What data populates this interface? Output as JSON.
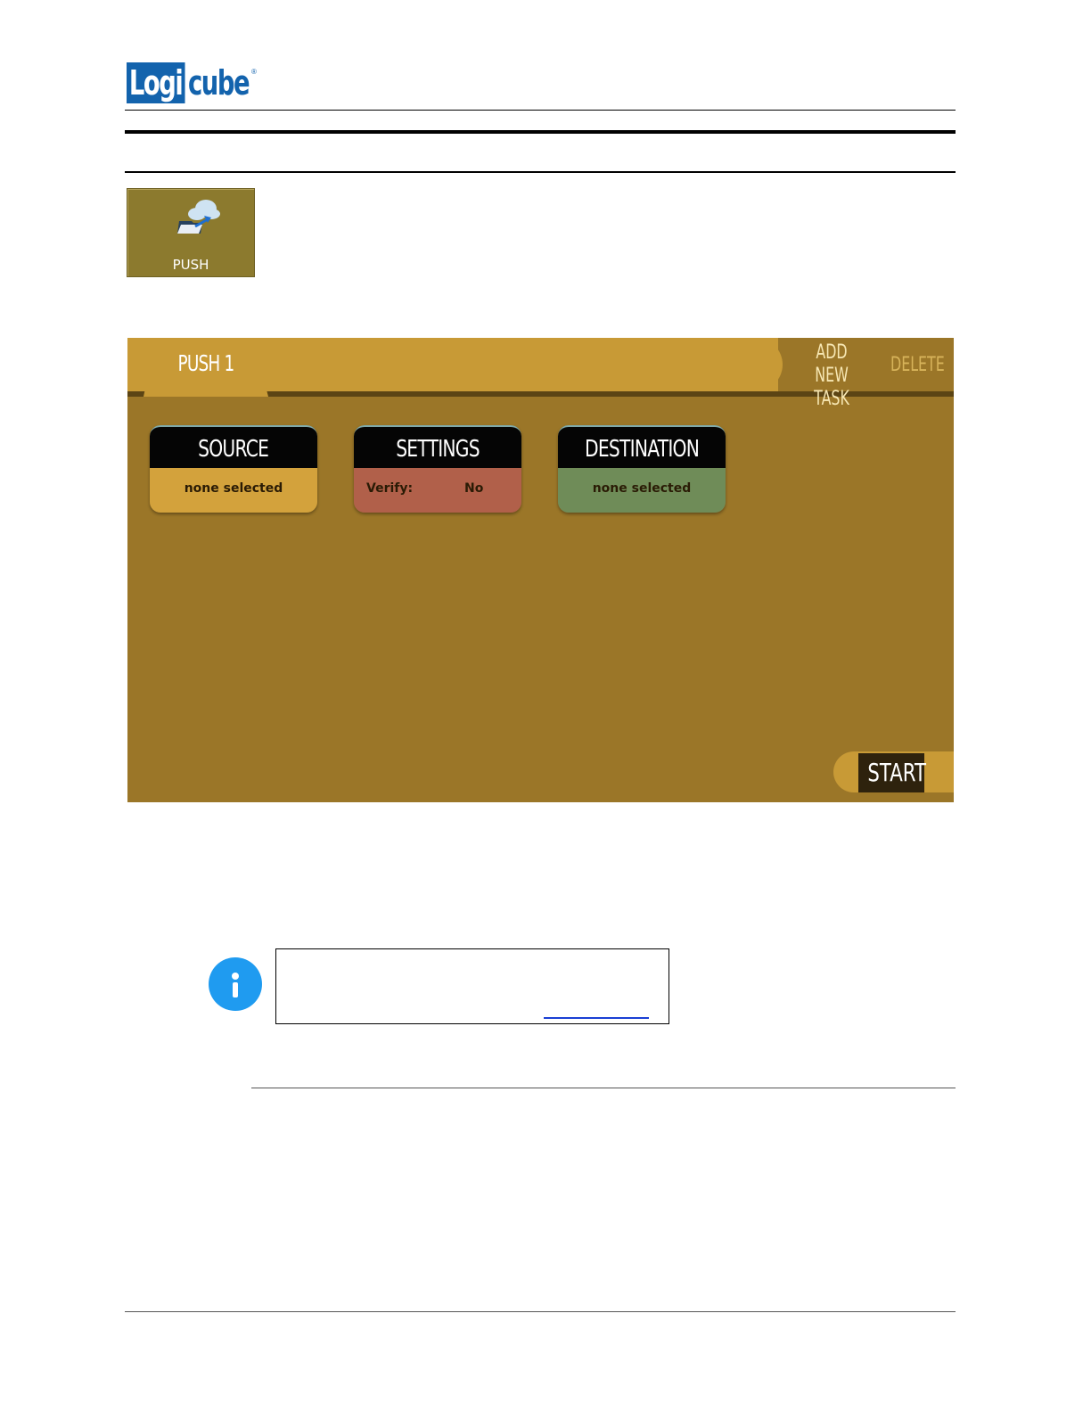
{
  "header": {
    "logo_block": "Logi",
    "logo_rest": "cube",
    "logo_mark": "®"
  },
  "push_icon": {
    "label": "PUSH",
    "icon": "cloud-upload-folder-icon"
  },
  "screen": {
    "tab_label": "PUSH 1",
    "add_new_task": "ADD NEW TASK",
    "delete_label": "DELETE",
    "cards": {
      "source": {
        "title": "SOURCE",
        "value": "none selected"
      },
      "settings": {
        "title": "SETTINGS",
        "key": "Verify:",
        "value": "No"
      },
      "destination": {
        "title": "DESTINATION",
        "value": "none selected"
      }
    },
    "start_label": "START"
  },
  "colors": {
    "logo_blue": "#1363ad",
    "screen_bg": "#9b7628",
    "bar_gold": "#c89a36",
    "source_body": "#d3a23c",
    "settings_body": "#b1604a",
    "destination_body": "#6f8c58",
    "info_blue": "#1f9bf0"
  },
  "note": {
    "icon": "info-icon"
  }
}
